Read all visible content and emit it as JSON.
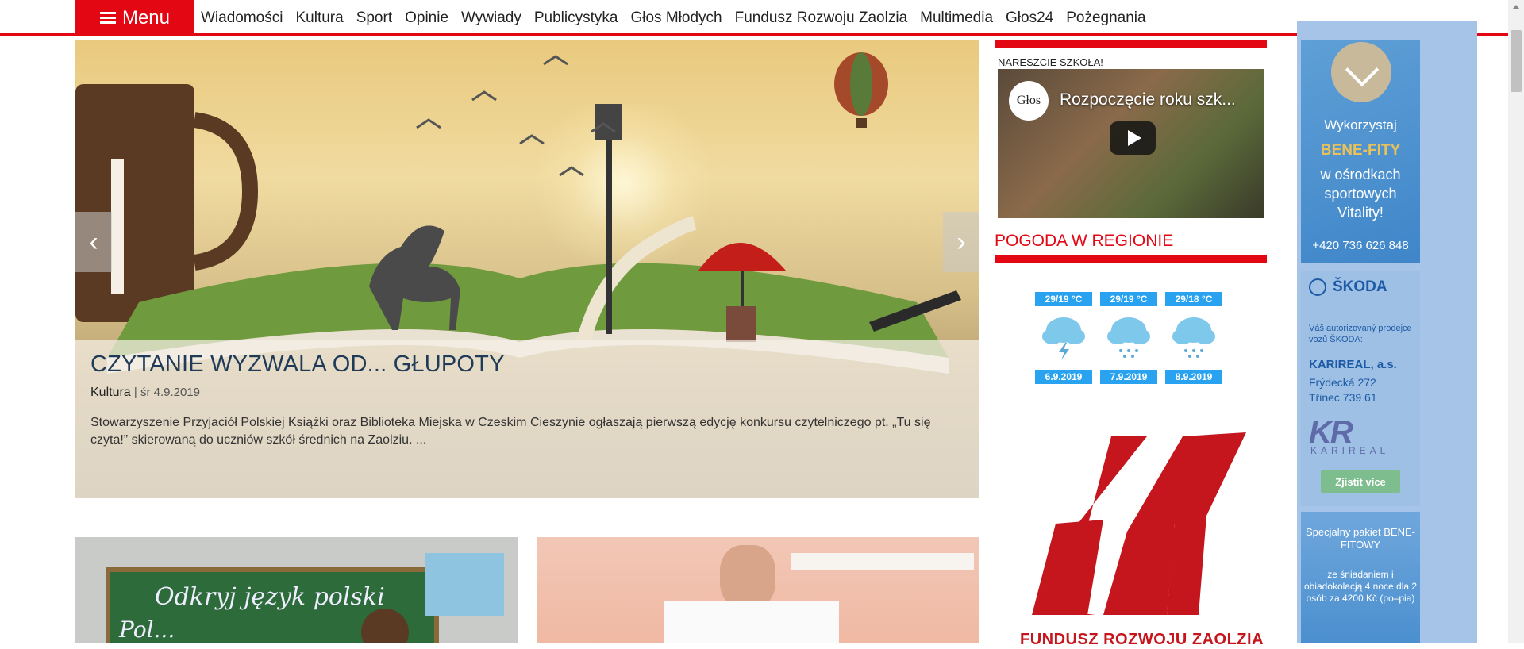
{
  "header": {
    "menu_label": "Menu",
    "nav": [
      "Wiadomości",
      "Kultura",
      "Sport",
      "Opinie",
      "Wywiady",
      "Publicystyka",
      "Głos Młodych",
      "Fundusz Rozwoju Zaolzia",
      "Multimedia",
      "Głos24",
      "Pożegnania"
    ]
  },
  "hero": {
    "title": "CZYTANIE WYZWALA OD... GŁUPOTY",
    "category": "Kultura",
    "date": "| śr 4.9.2019",
    "excerpt": "Stowarzyszenie Przyjaciół Polskiej Książki oraz Biblioteka Miejska w Czeskim Cieszynie ogłaszają pierwszą edycję konkursu czytelniczego pt. „Tu się czyta!” skierowaną do uczniów szkół średnich na Zaolziu. ...",
    "prev": "‹",
    "next": "›"
  },
  "sidebar": {
    "video_label": "NARESZCIE SZKOŁA!",
    "video_channel": "Głos",
    "video_title": "Rozpoczęcie roku szk...",
    "weather_title": "POGODA W REGIONIE",
    "weather": [
      {
        "temp": "29/19 °C",
        "date": "6.9.2019",
        "icon": "storm-cloud-icon"
      },
      {
        "temp": "29/19 °C",
        "date": "7.9.2019",
        "icon": "rain-cloud-icon"
      },
      {
        "temp": "29/18 °C",
        "date": "8.9.2019",
        "icon": "rain-cloud-icon"
      }
    ],
    "fund_text": "FUNDUSZ ROZWOJU ZAOLZIA"
  },
  "ads": {
    "ad1": {
      "l1": "Wykorzystaj",
      "l2": "BENE-FITY",
      "l3": "w ośrodkach sportowych Vitality!",
      "phone": "+420 736 626 848"
    },
    "ad2": {
      "brand": "ŠKODA",
      "small": "Váš autorizovaný prodejce vozů ŠKODA:",
      "name": "KARIREAL, a.s.",
      "addr1": "Frýdecká 272",
      "addr2": "Třinec 739 61",
      "logo": "KR",
      "logo_text": "KARIREAL",
      "button": "Zjistit více"
    },
    "ad3": {
      "a": "Specjalny pakiet BENE-FITOWY",
      "b": "ze śniadaniem i obiadokolacją 4 noce dla 2 osób za 4200 Kč (po–pia)"
    }
  },
  "articles": {
    "thumb1_text1": "Odkryj język polski",
    "thumb1_text2": "Pol..."
  }
}
